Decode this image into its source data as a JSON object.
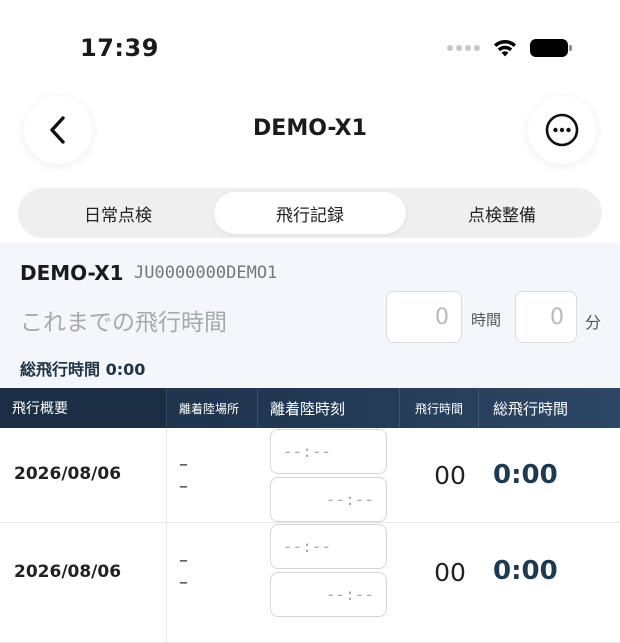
{
  "status_bar": {
    "time": "17:39",
    "icons": [
      "signal-dots-icon",
      "wifi-icon",
      "battery-icon"
    ]
  },
  "nav": {
    "back_icon": "chevron-left-icon",
    "title": "DEMO-X1",
    "more_icon": "ellipsis-circle-icon"
  },
  "tabs": [
    {
      "label": "日常点検",
      "active": false
    },
    {
      "label": "飛行記録",
      "active": true
    },
    {
      "label": "点検整備",
      "active": false
    }
  ],
  "aircraft": {
    "name": "DEMO-X1",
    "registration": "JU0000000DEMO1",
    "previous_time_label": "これまでの飛行時間",
    "hours_placeholder": "0",
    "hours_unit": "時間",
    "minutes_placeholder": "0",
    "minutes_unit": "分",
    "total_label": "総飛行時間 0:00"
  },
  "table": {
    "headers": {
      "summary": "飛行概要",
      "airport": "離着陸場所",
      "time": "離着陸時刻",
      "flight_time": "飛行時間",
      "total_time": "総飛行時間"
    },
    "rows": [
      {
        "date": "2026/08/06",
        "departure_place": "–",
        "arrival_place": "–",
        "departure_time": "--:--",
        "arrival_time": "--:--",
        "flight_time": "00",
        "total_time": "0:00"
      },
      {
        "date": "2026/08/06",
        "departure_place": "–",
        "arrival_place": "–",
        "departure_time": "--:--",
        "arrival_time": "--:--",
        "flight_time": "00",
        "total_time": "0:00"
      }
    ]
  },
  "colors": {
    "header_navy": "#1c3046",
    "total_text": "#1e3a52",
    "panel_bg": "#f3f6fa"
  }
}
